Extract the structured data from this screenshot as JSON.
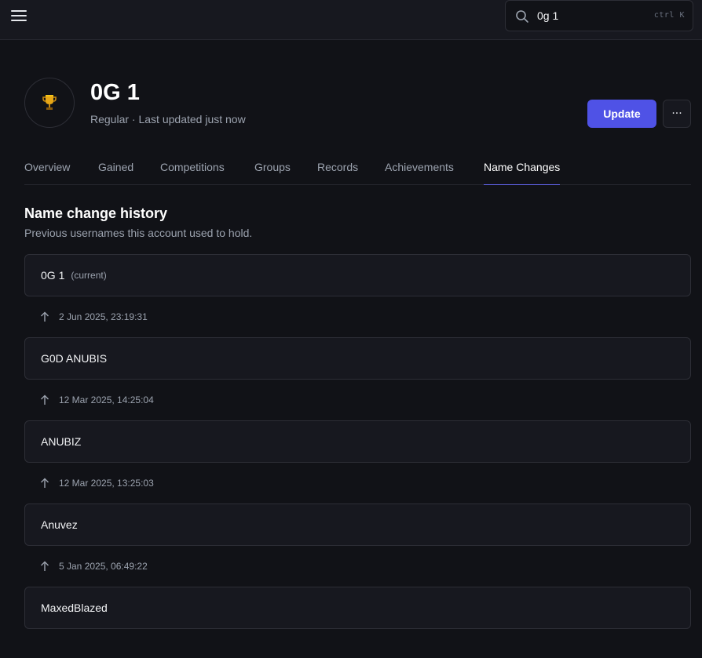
{
  "search": {
    "value": "0g 1",
    "shortcut": "ctrl K"
  },
  "player": {
    "name": "0G 1",
    "type": "Regular",
    "separator": "·",
    "last_updated": "Last updated just now"
  },
  "actions": {
    "update_label": "Update",
    "more_label": "···"
  },
  "tabs": [
    {
      "label": "Overview"
    },
    {
      "label": "Gained"
    },
    {
      "label": "Competitions"
    },
    {
      "label": "Groups"
    },
    {
      "label": "Records"
    },
    {
      "label": "Achievements"
    },
    {
      "label": "Name Changes",
      "active": true
    }
  ],
  "section": {
    "title": "Name change history",
    "description": "Previous usernames this account used to hold."
  },
  "names": [
    {
      "name": "0G 1",
      "tag": "(current)"
    },
    {
      "name": "G0D ANUBIS"
    },
    {
      "name": "ANUBIZ"
    },
    {
      "name": "Anuvez"
    },
    {
      "name": "MaxedBlazed"
    }
  ],
  "changes": [
    {
      "date": "2 Jun 2025, 23:19:31"
    },
    {
      "date": "12 Mar 2025, 14:25:04"
    },
    {
      "date": "12 Mar 2025, 13:25:03"
    },
    {
      "date": "5 Jan 2025, 06:49:22"
    }
  ],
  "colors": {
    "accent": "#4f52e6",
    "background": "#111217",
    "card": "#17181f"
  },
  "icons": {
    "menu": "menu-icon",
    "search": "search-icon",
    "avatar": "trophy-icon",
    "change": "arrow-up-icon"
  }
}
